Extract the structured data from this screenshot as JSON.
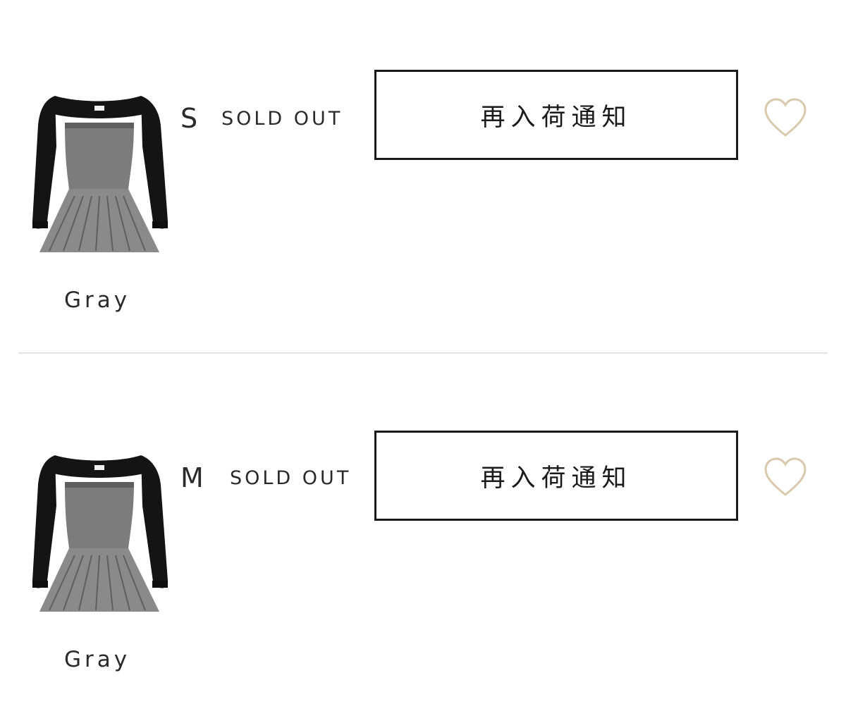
{
  "variants": [
    {
      "size": "S",
      "stock_status": "SOLD OUT",
      "color_name": "Gray",
      "notify_label": "再入荷通知",
      "favorite_icon": "heart-outline-icon"
    },
    {
      "size": "M",
      "stock_status": "SOLD OUT",
      "color_name": "Gray",
      "notify_label": "再入荷通知",
      "favorite_icon": "heart-outline-icon"
    }
  ],
  "colors": {
    "heart_stroke": "#d9c9ad",
    "button_border": "#1a1a1a",
    "divider": "#e3e3e3",
    "text": "#2a2a2a"
  }
}
